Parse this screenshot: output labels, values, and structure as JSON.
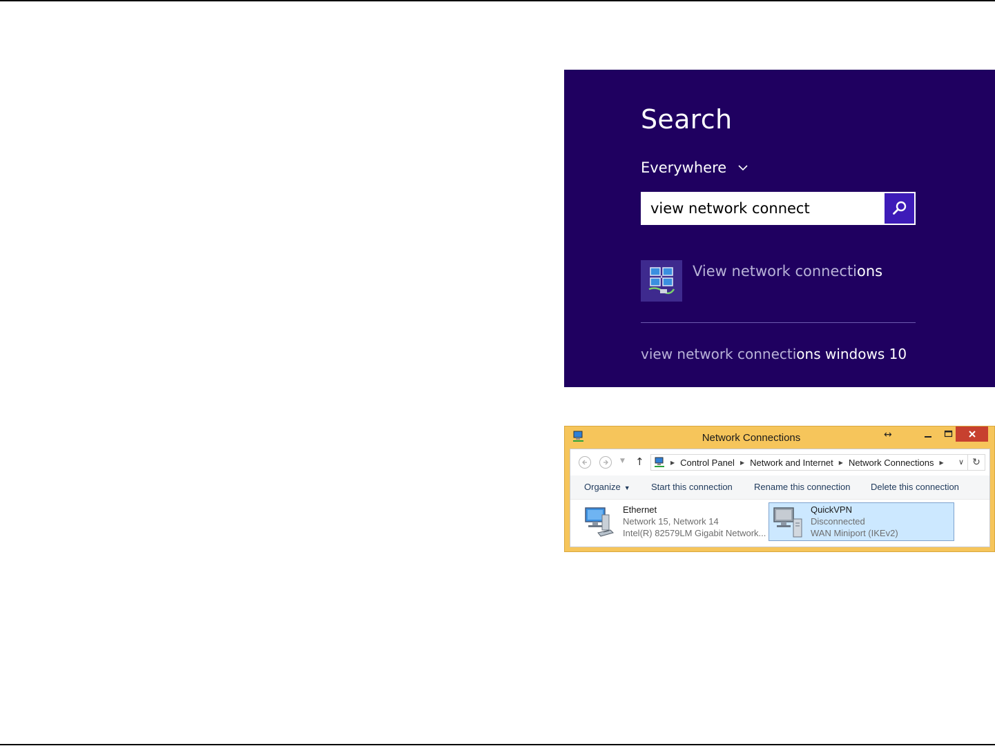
{
  "search_charm": {
    "title": "Search",
    "scope": "Everywhere",
    "query": "view network connect",
    "result_main": {
      "match": "View network connecti",
      "rest": "ons"
    },
    "suggestion": {
      "match": "view network connecti",
      "rest": "ons windows 10"
    },
    "colors": {
      "panel": "#1f0060",
      "search_button": "#3d1bb8"
    }
  },
  "network_window": {
    "title": "Network Connections",
    "resize_indicator": "↔",
    "breadcrumbs": [
      "Control Panel",
      "Network and Internet",
      "Network Connections"
    ],
    "commands": {
      "organize": "Organize",
      "start": "Start this connection",
      "rename": "Rename this connection",
      "delete": "Delete this connection"
    },
    "connections": [
      {
        "name": "Ethernet",
        "status": "Network  15, Network  14",
        "device": "Intel(R) 82579LM Gigabit Network..."
      },
      {
        "name": "QuickVPN",
        "status": "Disconnected",
        "device": "WAN Miniport (IKEv2)"
      }
    ],
    "colors": {
      "frame": "#f6c55b",
      "close_button": "#c7402f",
      "selection": "#cce8ff"
    }
  }
}
